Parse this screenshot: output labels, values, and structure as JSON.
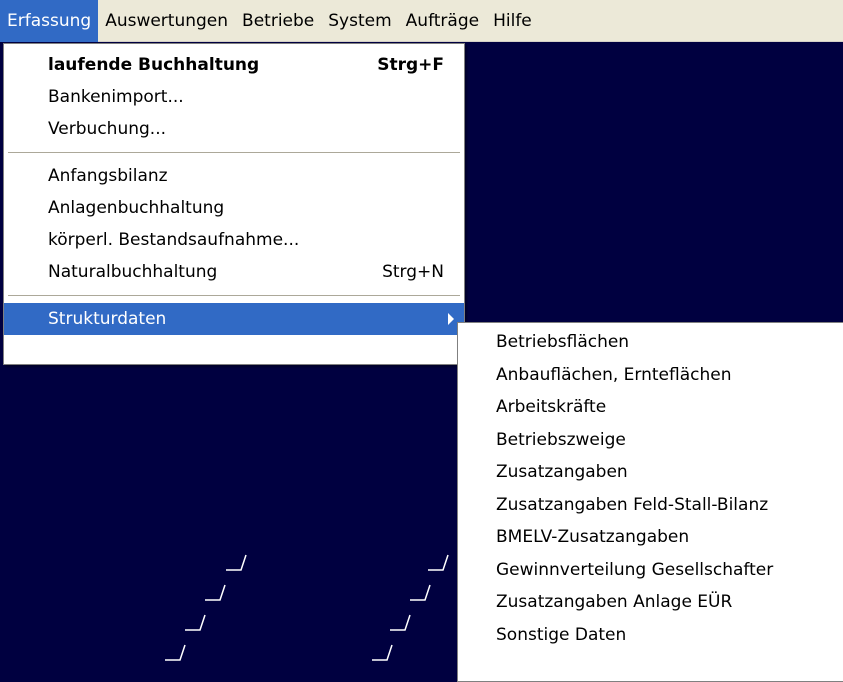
{
  "menubar": {
    "items": [
      "Erfassung",
      "Auswertungen",
      "Betriebe",
      "System",
      "Aufträge",
      "Hilfe"
    ]
  },
  "erfassung_menu": {
    "items": [
      {
        "label": "laufende Buchhaltung",
        "shortcut": "Strg+F"
      },
      {
        "label": "Bankenimport..."
      },
      {
        "label": "Verbuchung..."
      },
      {
        "label": "Anfangsbilanz"
      },
      {
        "label": "Anlagenbuchhaltung"
      },
      {
        "label": "körperl. Bestandsaufnahme..."
      },
      {
        "label": "Naturalbuchhaltung",
        "shortcut": "Strg+N"
      },
      {
        "label": "Strukturdaten"
      }
    ]
  },
  "strukturdaten_menu": {
    "items": [
      "Betriebsflächen",
      "Anbauflächen, Ernteflächen",
      "Arbeitskräfte",
      "Betriebszweige",
      "Zusatzangaben",
      "Zusatzangaben Feld-Stall-Bilanz",
      "BMELV-Zusatzangaben",
      "Gewinnverteilung Gesellschafter",
      "Zusatzangaben Anlage EÜR",
      "Sonstige Daten"
    ]
  },
  "colors": {
    "desktop": "#000040",
    "highlight": "#316ac5",
    "menubar": "#ece9d8"
  }
}
